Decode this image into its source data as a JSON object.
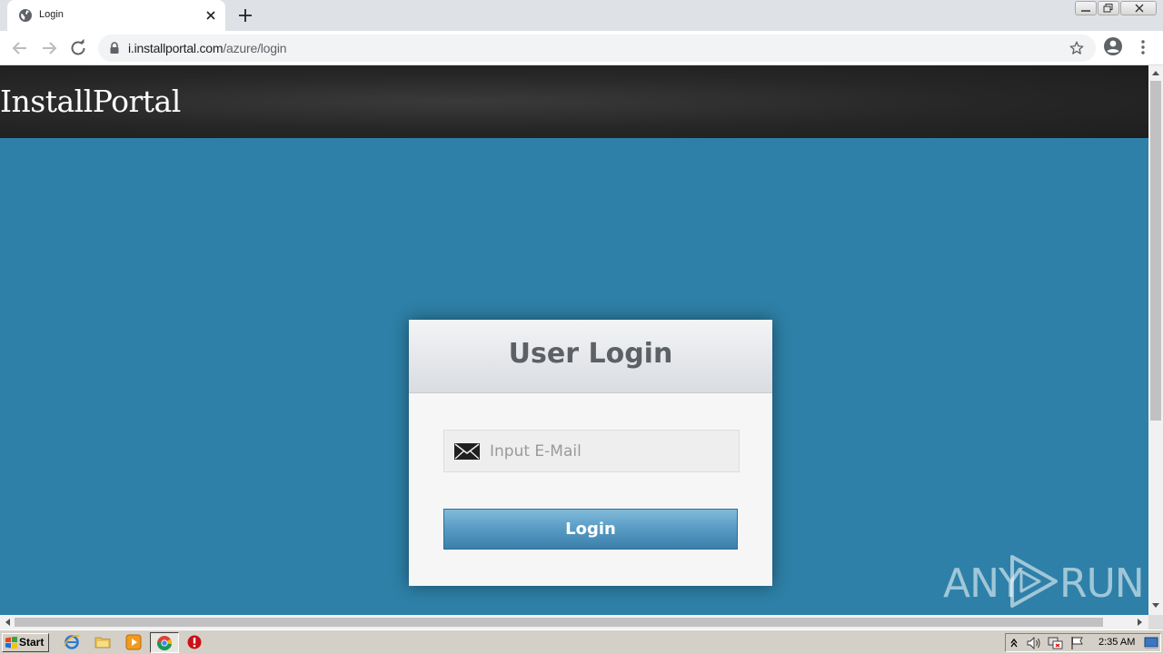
{
  "browser": {
    "tab": {
      "title": "Login"
    },
    "address": {
      "url_host": "i.installportal.com",
      "url_path": "/azure/login"
    }
  },
  "page": {
    "site_logo": "InstallPortal",
    "login_card": {
      "title": "User Login",
      "email_placeholder": "Input E-Mail",
      "email_value": "",
      "login_label": "Login"
    },
    "watermark": {
      "left": "ANY",
      "right": "RUN"
    }
  },
  "taskbar": {
    "start_label": "Start",
    "clock": "2:35 AM"
  },
  "colors": {
    "page_background": "#2e80a8",
    "header_background": "#262626",
    "button_gradient_top": "#82bbdb",
    "button_gradient_bottom": "#3c7fab"
  }
}
